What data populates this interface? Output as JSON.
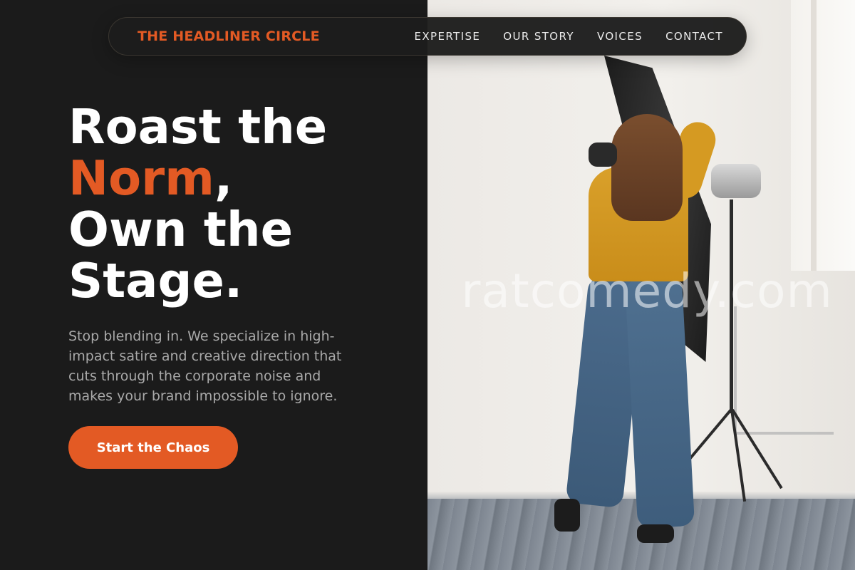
{
  "nav": {
    "brand": "THE HEADLINER CIRCLE",
    "links": [
      "EXPERTISE",
      "OUR STORY",
      "VOICES",
      "CONTACT"
    ]
  },
  "hero": {
    "headline_line1": "Roast the",
    "headline_accent": "Norm",
    "headline_comma": ",",
    "headline_line3": "Own the",
    "headline_line4": "Stage.",
    "subtext": "Stop blending in. We specialize in high-impact satire and creative direction that cuts through the corporate noise and makes your brand impossible to ignore.",
    "cta_label": "Start the Chaos"
  },
  "photo": {
    "watermark": "ratcomedy.com"
  },
  "colors": {
    "accent": "#e35a24",
    "background": "#1b1b1b",
    "text_muted": "#a9a9a9"
  },
  "icons": []
}
